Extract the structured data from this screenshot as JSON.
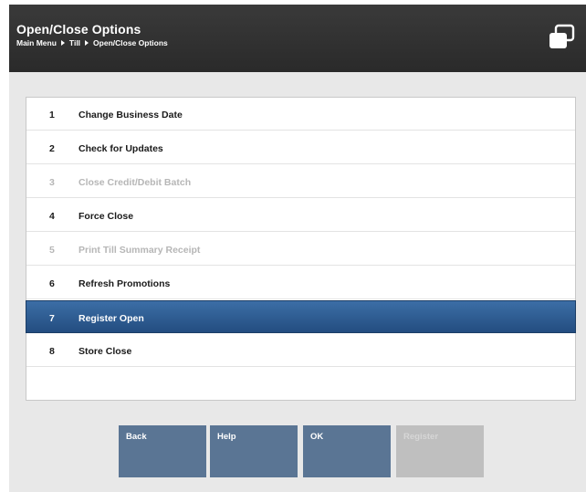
{
  "header": {
    "title": "Open/Close Options",
    "breadcrumb": [
      "Main Menu",
      "Till",
      "Open/Close Options"
    ]
  },
  "menu": {
    "items": [
      {
        "num": "1",
        "label": "Change Business Date",
        "enabled": true,
        "selected": false
      },
      {
        "num": "2",
        "label": "Check for Updates",
        "enabled": true,
        "selected": false
      },
      {
        "num": "3",
        "label": "Close Credit/Debit Batch",
        "enabled": false,
        "selected": false
      },
      {
        "num": "4",
        "label": "Force Close",
        "enabled": true,
        "selected": false
      },
      {
        "num": "5",
        "label": "Print Till Summary Receipt",
        "enabled": false,
        "selected": false
      },
      {
        "num": "6",
        "label": "Refresh Promotions",
        "enabled": true,
        "selected": false
      },
      {
        "num": "7",
        "label": "Register Open",
        "enabled": true,
        "selected": true
      },
      {
        "num": "8",
        "label": "Store Close",
        "enabled": true,
        "selected": false
      }
    ]
  },
  "buttons": {
    "back": "Back",
    "help": "Help",
    "ok": "OK",
    "register": "Register"
  },
  "colors": {
    "header_bg": "#2e2e2e",
    "selected_row": "#2f5e94",
    "button_bg": "#5a7594",
    "button_disabled": "#bfbfbf"
  }
}
